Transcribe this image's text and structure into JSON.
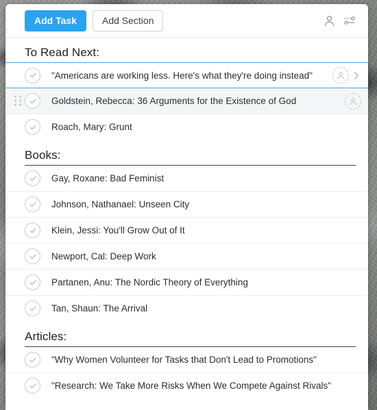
{
  "app": {
    "accent_color": "#2aa3ef",
    "selected_row_border_color": "#4aa3e8"
  },
  "toolbar": {
    "add_task_label": "Add Task",
    "add_section_label": "Add Section",
    "person_icon": "person-icon",
    "settings_icon": "sliders-icon"
  },
  "sections": [
    {
      "title": "To Read Next:",
      "tasks": [
        {
          "title": "\"Americans are working less. Here's what they're doing instead\"",
          "state": "selected",
          "has_assignee": true,
          "has_chevron": true,
          "has_drag_handle": false
        },
        {
          "title": "Goldstein, Rebecca: 36 Arguments for the Existence of God",
          "state": "hovered",
          "has_assignee": true,
          "has_chevron": false,
          "has_drag_handle": true
        },
        {
          "title": "Roach, Mary: Grunt",
          "state": "normal",
          "has_assignee": false,
          "has_chevron": false,
          "has_drag_handle": false
        }
      ]
    },
    {
      "title": "Books:",
      "tasks": [
        {
          "title": "Gay, Roxane: Bad Feminist",
          "state": "normal",
          "has_assignee": false,
          "has_chevron": false,
          "has_drag_handle": false
        },
        {
          "title": "Johnson, Nathanael: Unseen City",
          "state": "normal",
          "has_assignee": false,
          "has_chevron": false,
          "has_drag_handle": false
        },
        {
          "title": "Klein, Jessi: You'll Grow Out of It",
          "state": "normal",
          "has_assignee": false,
          "has_chevron": false,
          "has_drag_handle": false
        },
        {
          "title": "Newport, Cal: Deep Work",
          "state": "normal",
          "has_assignee": false,
          "has_chevron": false,
          "has_drag_handle": false
        },
        {
          "title": "Partanen, Anu: The Nordic Theory of Everything",
          "state": "normal",
          "has_assignee": false,
          "has_chevron": false,
          "has_drag_handle": false
        },
        {
          "title": "Tan, Shaun: The Arrival",
          "state": "normal",
          "has_assignee": false,
          "has_chevron": false,
          "has_drag_handle": false
        }
      ]
    },
    {
      "title": "Articles:",
      "tasks": [
        {
          "title": "\"Why Women Volunteer for Tasks that Don't Lead to Promotions\"",
          "state": "normal",
          "has_assignee": false,
          "has_chevron": false,
          "has_drag_handle": false
        },
        {
          "title": "\"Research: We Take More Risks When We Compete Against Rivals\"",
          "state": "normal",
          "has_assignee": false,
          "has_chevron": false,
          "has_drag_handle": false
        }
      ]
    }
  ]
}
